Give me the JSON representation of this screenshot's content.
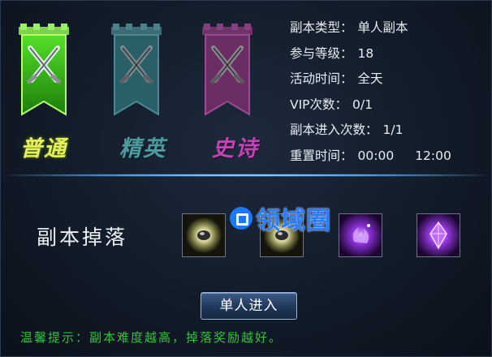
{
  "modes": [
    {
      "label": "普通",
      "color": "#e7f060",
      "banner": "#2fb614"
    },
    {
      "label": "精英",
      "color": "#4e9a9e",
      "banner": "#2f6a73"
    },
    {
      "label": "史诗",
      "color": "#c046b6",
      "banner": "#7a2f74"
    }
  ],
  "info": {
    "type_label": "副本类型：",
    "type_value": "单人副本",
    "level_label": "参与等级：",
    "level_value": "18",
    "time_label": "活动时间：",
    "time_value": "全天",
    "vip_label": "VIP次数：",
    "vip_value": "0/1",
    "entries_label": "副本进入次数：",
    "entries_value": "1/1",
    "reset_label": "重置时间：",
    "reset_a": "00:00",
    "reset_b": "12:00"
  },
  "drops": {
    "title": "副本掉落",
    "items": [
      "gold-stone-icon",
      "gold-stone-icon",
      "purple-gem-icon",
      "purple-gem-icon"
    ]
  },
  "watermark": "领域圈",
  "enter_button": "单人进入",
  "tip": "温馨提示：副本难度越高，掉落奖励越好。"
}
